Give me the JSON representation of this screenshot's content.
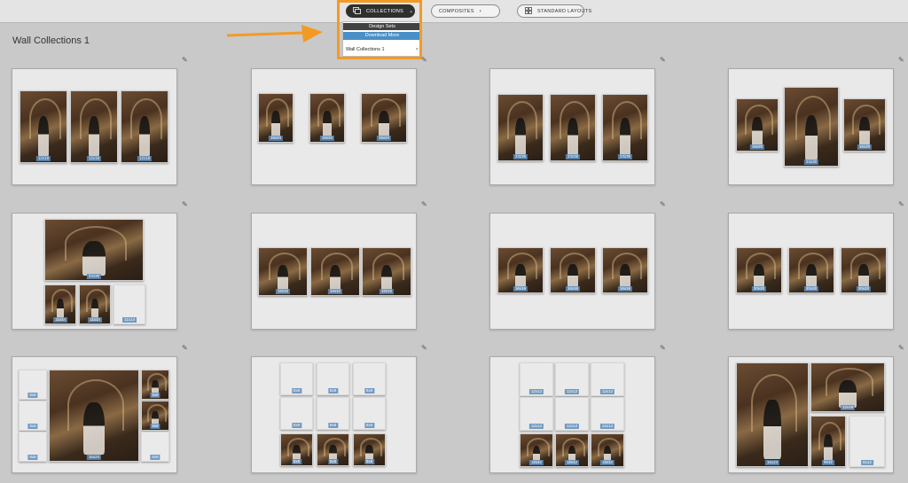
{
  "toolbar": {
    "collections_label": "COLLECTIONS",
    "composites_label": "COMPOSITES",
    "standard_layouts_label": "STANDARD LAYOUTS"
  },
  "dropdown": {
    "header": "Design Sets",
    "download_more": "Download More",
    "item": "Wall Collections 1",
    "close": "×"
  },
  "page_title": "Wall Collections 1",
  "edit_glyph": "✎",
  "accent_color": "#f39a24",
  "tag_color": "#5d8cba",
  "cards": [
    {
      "frames": [
        {
          "k": "photo",
          "size": "12x18"
        },
        {
          "k": "photo",
          "size": "12x18"
        },
        {
          "k": "photo",
          "size": "12x18"
        }
      ]
    },
    {
      "frames": [
        {
          "k": "photo",
          "size": "16x24"
        },
        {
          "k": "photo",
          "size": "16x24"
        },
        {
          "k": "photo",
          "size": "16x24"
        }
      ]
    },
    {
      "frames": [
        {
          "k": "photo",
          "size": "24x36"
        },
        {
          "k": "photo",
          "size": "24x36"
        },
        {
          "k": "photo",
          "size": "24x36"
        }
      ]
    },
    {
      "frames": [
        {
          "k": "photo",
          "size": "16x20"
        },
        {
          "k": "photo",
          "size": "24x30"
        },
        {
          "k": "photo",
          "size": "16x20"
        }
      ]
    },
    {
      "frames": [
        {
          "k": "photo",
          "size": "22x30"
        },
        {
          "k": "photo",
          "size": "11x14"
        },
        {
          "k": "photo",
          "size": "11x14"
        },
        {
          "k": "blank",
          "size": "11x14"
        }
      ]
    },
    {
      "frames": [
        {
          "k": "photo",
          "size": "12x12"
        },
        {
          "k": "photo",
          "size": "12x12"
        },
        {
          "k": "photo",
          "size": "12x12"
        }
      ]
    },
    {
      "frames": [
        {
          "k": "photo",
          "size": "16x16"
        },
        {
          "k": "photo",
          "size": "16x16"
        },
        {
          "k": "photo",
          "size": "16x16"
        }
      ]
    },
    {
      "frames": [
        {
          "k": "photo",
          "size": "20x20"
        },
        {
          "k": "photo",
          "size": "20x20"
        },
        {
          "k": "photo",
          "size": "20x20"
        }
      ]
    },
    {
      "frames": [
        {
          "k": "blank",
          "size": "8x8"
        },
        {
          "k": "blank",
          "size": "8x8"
        },
        {
          "k": "blank",
          "size": "8x8"
        },
        {
          "k": "photo",
          "size": "16x24"
        },
        {
          "k": "photo",
          "size": "8x8"
        },
        {
          "k": "photo",
          "size": "8x8"
        },
        {
          "k": "blank",
          "size": "8x8"
        }
      ]
    },
    {
      "frames": [
        {
          "k": "blank",
          "size": "8x8"
        },
        {
          "k": "blank",
          "size": "8x8"
        },
        {
          "k": "blank",
          "size": "8x8"
        },
        {
          "k": "blank",
          "size": "8x8"
        },
        {
          "k": "blank",
          "size": "8x8"
        },
        {
          "k": "blank",
          "size": "8x8"
        },
        {
          "k": "photo",
          "size": "8x8"
        },
        {
          "k": "photo",
          "size": "8x8"
        },
        {
          "k": "photo",
          "size": "8x8"
        }
      ]
    },
    {
      "frames": [
        {
          "k": "blank",
          "size": "12x12"
        },
        {
          "k": "blank",
          "size": "12x12"
        },
        {
          "k": "blank",
          "size": "12x12"
        },
        {
          "k": "blank",
          "size": "12x12"
        },
        {
          "k": "blank",
          "size": "12x12"
        },
        {
          "k": "blank",
          "size": "12x12"
        },
        {
          "k": "photo",
          "size": "12x12"
        },
        {
          "k": "photo",
          "size": "12x12"
        },
        {
          "k": "photo",
          "size": "12x12"
        }
      ]
    },
    {
      "frames": [
        {
          "k": "photo",
          "size": "16x24"
        },
        {
          "k": "photo",
          "size": "12x18"
        },
        {
          "k": "photo",
          "size": "8x12"
        },
        {
          "k": "blank",
          "size": "8x12"
        }
      ]
    }
  ]
}
